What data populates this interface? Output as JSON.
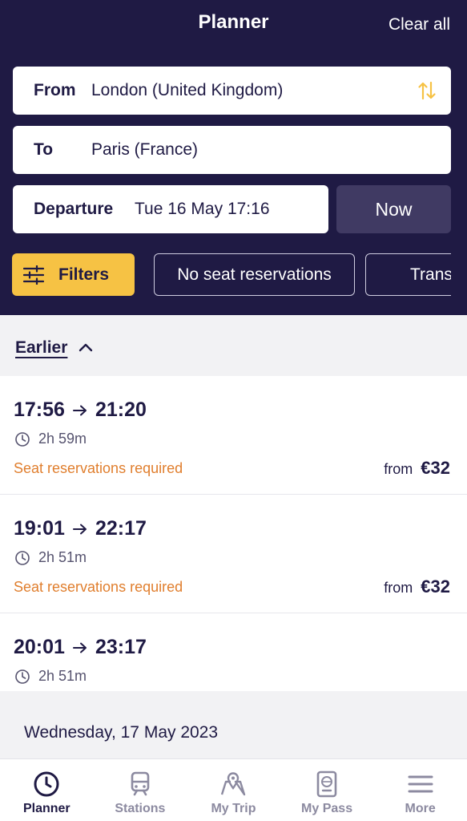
{
  "header": {
    "title": "Planner",
    "clear_all": "Clear all"
  },
  "form": {
    "from_label": "From",
    "from_value": "London (United Kingdom)",
    "to_label": "To",
    "to_value": "Paris (France)",
    "departure_label": "Departure",
    "departure_value": "Tue 16 May 17:16",
    "now_button": "Now"
  },
  "chips": {
    "filters": "Filters",
    "no_seat": "No seat reservations",
    "transfers": "Transfers"
  },
  "earlier": "Earlier",
  "journeys": [
    {
      "depart": "17:56",
      "arrive": "21:20",
      "duration": "2h 59m",
      "note": "Seat reservations required",
      "price_prefix": "from",
      "price": "€32"
    },
    {
      "depart": "19:01",
      "arrive": "22:17",
      "duration": "2h 51m",
      "note": "Seat reservations required",
      "price_prefix": "from",
      "price": "€32"
    },
    {
      "depart": "20:01",
      "arrive": "23:17",
      "duration": "2h 51m"
    }
  ],
  "day_separator": "Wednesday, 17 May 2023",
  "tabs": [
    {
      "label": "Planner",
      "icon": "clock-icon"
    },
    {
      "label": "Stations",
      "icon": "train-icon"
    },
    {
      "label": "My Trip",
      "icon": "map-pin-icon"
    },
    {
      "label": "My Pass",
      "icon": "passport-icon"
    },
    {
      "label": "More",
      "icon": "menu-icon"
    }
  ],
  "colors": {
    "header_bg": "#1f1a44",
    "accent_yellow": "#f6c244",
    "warning_orange": "#e07e2d",
    "now_button_bg": "#403a63"
  }
}
